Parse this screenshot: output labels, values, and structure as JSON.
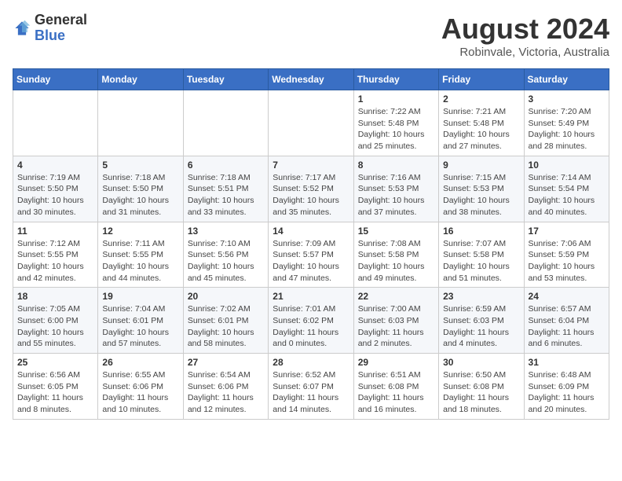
{
  "header": {
    "logo_general": "General",
    "logo_blue": "Blue",
    "month_year": "August 2024",
    "location": "Robinvale, Victoria, Australia"
  },
  "days_of_week": [
    "Sunday",
    "Monday",
    "Tuesday",
    "Wednesday",
    "Thursday",
    "Friday",
    "Saturday"
  ],
  "weeks": [
    {
      "cells": [
        {
          "day": "",
          "info": ""
        },
        {
          "day": "",
          "info": ""
        },
        {
          "day": "",
          "info": ""
        },
        {
          "day": "",
          "info": ""
        },
        {
          "day": "1",
          "info": "Sunrise: 7:22 AM\nSunset: 5:48 PM\nDaylight: 10 hours\nand 25 minutes."
        },
        {
          "day": "2",
          "info": "Sunrise: 7:21 AM\nSunset: 5:48 PM\nDaylight: 10 hours\nand 27 minutes."
        },
        {
          "day": "3",
          "info": "Sunrise: 7:20 AM\nSunset: 5:49 PM\nDaylight: 10 hours\nand 28 minutes."
        }
      ]
    },
    {
      "cells": [
        {
          "day": "4",
          "info": "Sunrise: 7:19 AM\nSunset: 5:50 PM\nDaylight: 10 hours\nand 30 minutes."
        },
        {
          "day": "5",
          "info": "Sunrise: 7:18 AM\nSunset: 5:50 PM\nDaylight: 10 hours\nand 31 minutes."
        },
        {
          "day": "6",
          "info": "Sunrise: 7:18 AM\nSunset: 5:51 PM\nDaylight: 10 hours\nand 33 minutes."
        },
        {
          "day": "7",
          "info": "Sunrise: 7:17 AM\nSunset: 5:52 PM\nDaylight: 10 hours\nand 35 minutes."
        },
        {
          "day": "8",
          "info": "Sunrise: 7:16 AM\nSunset: 5:53 PM\nDaylight: 10 hours\nand 37 minutes."
        },
        {
          "day": "9",
          "info": "Sunrise: 7:15 AM\nSunset: 5:53 PM\nDaylight: 10 hours\nand 38 minutes."
        },
        {
          "day": "10",
          "info": "Sunrise: 7:14 AM\nSunset: 5:54 PM\nDaylight: 10 hours\nand 40 minutes."
        }
      ]
    },
    {
      "cells": [
        {
          "day": "11",
          "info": "Sunrise: 7:12 AM\nSunset: 5:55 PM\nDaylight: 10 hours\nand 42 minutes."
        },
        {
          "day": "12",
          "info": "Sunrise: 7:11 AM\nSunset: 5:55 PM\nDaylight: 10 hours\nand 44 minutes."
        },
        {
          "day": "13",
          "info": "Sunrise: 7:10 AM\nSunset: 5:56 PM\nDaylight: 10 hours\nand 45 minutes."
        },
        {
          "day": "14",
          "info": "Sunrise: 7:09 AM\nSunset: 5:57 PM\nDaylight: 10 hours\nand 47 minutes."
        },
        {
          "day": "15",
          "info": "Sunrise: 7:08 AM\nSunset: 5:58 PM\nDaylight: 10 hours\nand 49 minutes."
        },
        {
          "day": "16",
          "info": "Sunrise: 7:07 AM\nSunset: 5:58 PM\nDaylight: 10 hours\nand 51 minutes."
        },
        {
          "day": "17",
          "info": "Sunrise: 7:06 AM\nSunset: 5:59 PM\nDaylight: 10 hours\nand 53 minutes."
        }
      ]
    },
    {
      "cells": [
        {
          "day": "18",
          "info": "Sunrise: 7:05 AM\nSunset: 6:00 PM\nDaylight: 10 hours\nand 55 minutes."
        },
        {
          "day": "19",
          "info": "Sunrise: 7:04 AM\nSunset: 6:01 PM\nDaylight: 10 hours\nand 57 minutes."
        },
        {
          "day": "20",
          "info": "Sunrise: 7:02 AM\nSunset: 6:01 PM\nDaylight: 10 hours\nand 58 minutes."
        },
        {
          "day": "21",
          "info": "Sunrise: 7:01 AM\nSunset: 6:02 PM\nDaylight: 11 hours\nand 0 minutes."
        },
        {
          "day": "22",
          "info": "Sunrise: 7:00 AM\nSunset: 6:03 PM\nDaylight: 11 hours\nand 2 minutes."
        },
        {
          "day": "23",
          "info": "Sunrise: 6:59 AM\nSunset: 6:03 PM\nDaylight: 11 hours\nand 4 minutes."
        },
        {
          "day": "24",
          "info": "Sunrise: 6:57 AM\nSunset: 6:04 PM\nDaylight: 11 hours\nand 6 minutes."
        }
      ]
    },
    {
      "cells": [
        {
          "day": "25",
          "info": "Sunrise: 6:56 AM\nSunset: 6:05 PM\nDaylight: 11 hours\nand 8 minutes."
        },
        {
          "day": "26",
          "info": "Sunrise: 6:55 AM\nSunset: 6:06 PM\nDaylight: 11 hours\nand 10 minutes."
        },
        {
          "day": "27",
          "info": "Sunrise: 6:54 AM\nSunset: 6:06 PM\nDaylight: 11 hours\nand 12 minutes."
        },
        {
          "day": "28",
          "info": "Sunrise: 6:52 AM\nSunset: 6:07 PM\nDaylight: 11 hours\nand 14 minutes."
        },
        {
          "day": "29",
          "info": "Sunrise: 6:51 AM\nSunset: 6:08 PM\nDaylight: 11 hours\nand 16 minutes."
        },
        {
          "day": "30",
          "info": "Sunrise: 6:50 AM\nSunset: 6:08 PM\nDaylight: 11 hours\nand 18 minutes."
        },
        {
          "day": "31",
          "info": "Sunrise: 6:48 AM\nSunset: 6:09 PM\nDaylight: 11 hours\nand 20 minutes."
        }
      ]
    }
  ]
}
